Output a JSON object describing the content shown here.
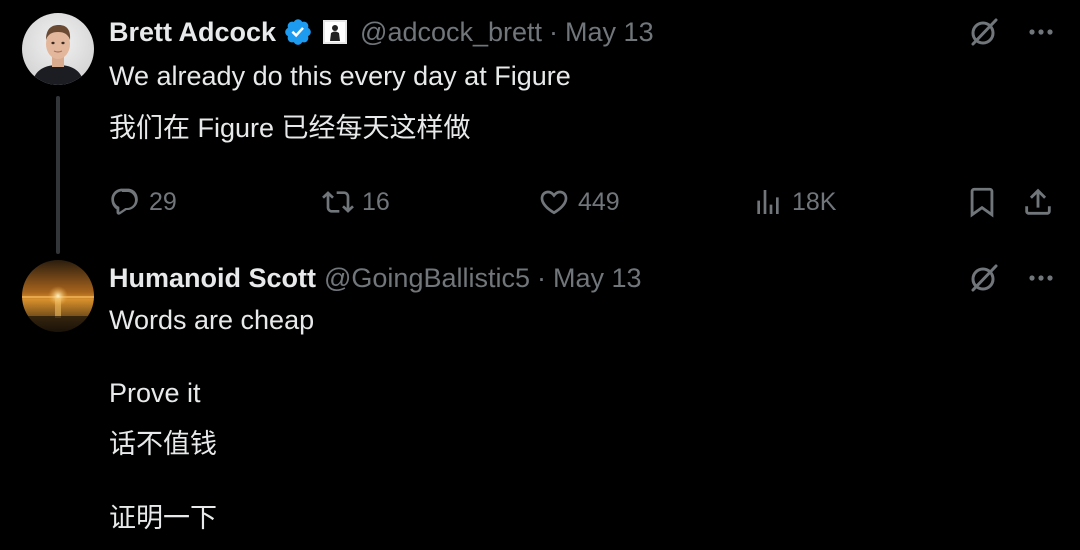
{
  "tweets": [
    {
      "display_name": "Brett Adcock",
      "handle": "@adcock_brett",
      "separator": "·",
      "date": "May 13",
      "verified": true,
      "affiliation_icon": "figure-logo-icon",
      "body": [
        "We already do this every day at Figure",
        "我们在 Figure 已经每天这样做"
      ],
      "actions": {
        "replies": "29",
        "reposts": "16",
        "likes": "449",
        "views": "18K"
      }
    },
    {
      "display_name": "Humanoid Scott",
      "handle": "@GoingBallistic5",
      "separator": "·",
      "date": "May 13",
      "verified": false,
      "body": [
        "Words are cheap",
        "Prove it",
        "话不值钱",
        "证明一下"
      ]
    }
  ],
  "icons": {
    "verified": "verified-badge-icon",
    "grok": "grok-icon",
    "more": "more-icon",
    "reply": "reply-icon",
    "repost": "repost-icon",
    "like": "like-icon",
    "views": "views-icon",
    "bookmark": "bookmark-icon",
    "share": "share-icon"
  },
  "colors": {
    "background": "#000000",
    "text": "#e7e9ea",
    "secondary": "#71767b",
    "verified": "#1d9bf0",
    "thread_line": "#333639"
  }
}
